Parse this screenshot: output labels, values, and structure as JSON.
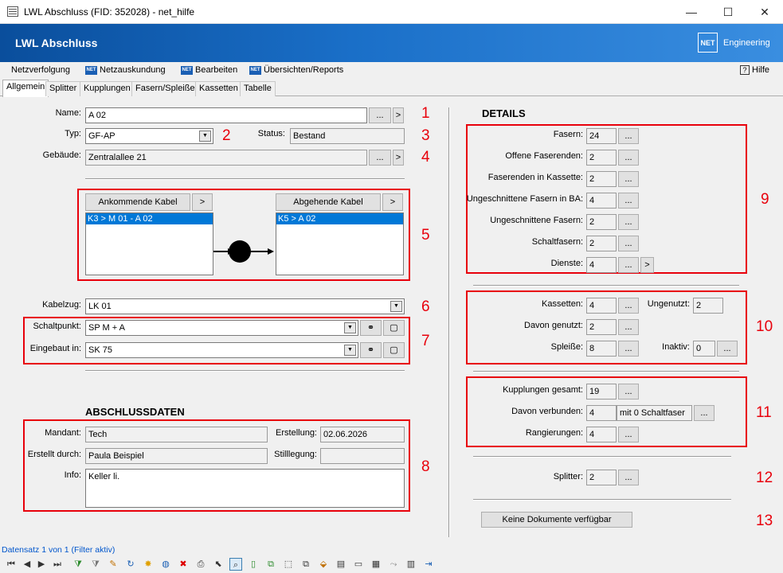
{
  "window": {
    "title": "LWL Abschluss (FID: 352028) - net_hilfe",
    "min": "—",
    "max": "☐",
    "close": "✕"
  },
  "banner": {
    "title": "LWL Abschluss",
    "logo": "NET",
    "logo_text": "Engineering"
  },
  "menu": {
    "items": [
      "Netzverfolgung",
      "Netzauskundung",
      "Bearbeiten",
      "Übersichten/Reports"
    ],
    "help": "Hilfe",
    "help_icon": "?"
  },
  "tabs": [
    "Allgemein",
    "Splitter",
    "Kupplungen",
    "Fasern/Spleiße",
    "Kassetten",
    "Tabelle"
  ],
  "form": {
    "name_label": "Name:",
    "name_value": "A 02",
    "typ_label": "Typ:",
    "typ_value": "GF-AP",
    "status_label": "Status:",
    "status_value": "Bestand",
    "gebaeude_label": "Gebäude:",
    "gebaeude_value": "Zentralallee 21",
    "dots": "...",
    "arrow": ">",
    "incoming_label": "Ankommende Kabel",
    "incoming_items": [
      "K3 > M 01 - A 02"
    ],
    "outgoing_label": "Abgehende Kabel",
    "outgoing_items": [
      "K5 > A 02"
    ],
    "kabelzug_label": "Kabelzug:",
    "kabelzug_value": "LK 01",
    "schaltpunkt_label": "Schaltpunkt:",
    "schaltpunkt_value": "SP M + A",
    "eingebaut_label": "Eingebaut in:",
    "eingebaut_value": "SK 75"
  },
  "abschluss": {
    "title": "ABSCHLUSSDATEN",
    "mandant_label": "Mandant:",
    "mandant_value": "Tech",
    "erstellung_label": "Erstellung:",
    "erstellung_value": "02.06.2026",
    "erstellt_label": "Erstellt durch:",
    "erstellt_value": "Paula Beispiel",
    "stilllegung_label": "Stilllegung:",
    "stilllegung_value": "",
    "info_label": "Info:",
    "info_value": "Keller li."
  },
  "details": {
    "title": "DETAILS",
    "rows": [
      {
        "label": "Fasern:",
        "value": "24"
      },
      {
        "label": "Offene Faserenden:",
        "value": "2"
      },
      {
        "label": "Faserenden in Kassette:",
        "value": "2"
      },
      {
        "label": "Ungeschnittene Fasern in BA:",
        "value": "4"
      },
      {
        "label": "Ungeschnittene Fasern:",
        "value": "2"
      },
      {
        "label": "Schaltfasern:",
        "value": "2"
      },
      {
        "label": "Dienste:",
        "value": "4"
      }
    ],
    "kassetten_label": "Kassetten:",
    "kassetten_value": "4",
    "ungenutzt_label": "Ungenutzt:",
    "ungenutzt_value": "2",
    "genutzt_label": "Davon genutzt:",
    "genutzt_value": "2",
    "spleisse_label": "Spleiße:",
    "spleisse_value": "8",
    "inaktiv_label": "Inaktiv:",
    "inaktiv_value": "0",
    "kupplungen_label": "Kupplungen gesamt:",
    "kupplungen_value": "19",
    "verbunden_label": "Davon verbunden:",
    "verbunden_value": "4",
    "verbunden_extra": "mit 0 Schaltfaser",
    "rangierungen_label": "Rangierungen:",
    "rangierungen_value": "4",
    "splitter_label": "Splitter:",
    "splitter_value": "2",
    "dokumente_label": "Keine Dokumente verfügbar"
  },
  "callouts": [
    "1",
    "2",
    "3",
    "4",
    "5",
    "6",
    "7",
    "8",
    "9",
    "10",
    "11",
    "12",
    "13"
  ],
  "statusbar": {
    "text": "Datensatz 1 von 1 (Filter aktiv)"
  },
  "colors": {
    "accent": "#0a4e9c",
    "callout": "#e8000b",
    "selection": "#0078d7"
  }
}
